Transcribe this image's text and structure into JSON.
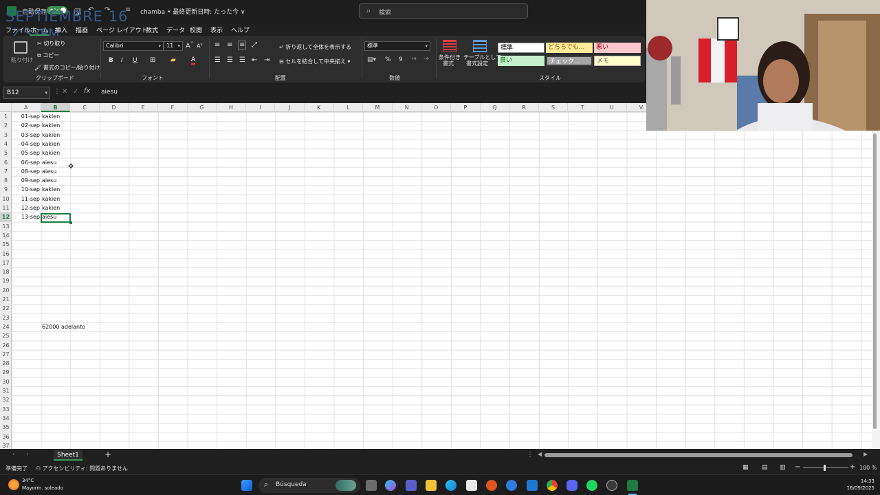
{
  "overlay": {
    "date": "SEPTIEMBRE 16",
    "time": "2:33PM"
  },
  "titlebar": {
    "autosave_label": "自動保存",
    "autosave_state": "オン",
    "doc_title": "chamba • 最終更新日時: たった今 ∨",
    "search_placeholder": "検索"
  },
  "menu_tabs": [
    "ファイル",
    "ホーム",
    "挿入",
    "描画",
    "ページ レイアウト",
    "数式",
    "データ",
    "校閲",
    "表示",
    "ヘルプ"
  ],
  "ribbon": {
    "clipboard": {
      "paste": "貼り付け",
      "cut": "切り取り",
      "copy": "コピー",
      "format_painter": "書式のコピー/貼り付け",
      "label": "クリップボード"
    },
    "font": {
      "name": "Calibri",
      "size": "11",
      "grow": "A",
      "shrink": "A",
      "bold": "B",
      "italic": "I",
      "underline": "U",
      "font_color": "A",
      "label": "フォント"
    },
    "alignment": {
      "wrap": "折り返して全体を表示する",
      "merge": "セルを結合して中央揃え",
      "label": "配置"
    },
    "number": {
      "format": "標準",
      "percent": "%",
      "comma": "9",
      "label": "数値"
    },
    "styles": {
      "conditional": [
        "条件付き",
        "書式"
      ],
      "table": [
        "テーブルとして",
        "書式設定"
      ],
      "cells": [
        "標準",
        "どちらでも...",
        "悪い",
        "良い",
        "チェック...",
        "メモ"
      ],
      "label": "スタイル"
    }
  },
  "formula_bar": {
    "cell_ref": "B12",
    "fx": "fx",
    "value": "aiesu"
  },
  "grid": {
    "columns": [
      "A",
      "B",
      "C",
      "D",
      "E",
      "F",
      "G",
      "H",
      "I",
      "J",
      "K",
      "L",
      "M",
      "N",
      "O",
      "P",
      "Q",
      "R",
      "S",
      "T",
      "U",
      "V"
    ],
    "row_count": 37,
    "rows": [
      {
        "date": "01-sep",
        "value": "kakien"
      },
      {
        "date": "02-sep",
        "value": "kakien"
      },
      {
        "date": "03-sep",
        "value": "kakien"
      },
      {
        "date": "04-sep",
        "value": "kakien"
      },
      {
        "date": "05-sep",
        "value": "kakien"
      },
      {
        "date": "06-sep",
        "value": "aiesu"
      },
      {
        "date": "08-sep",
        "value": "aiesu"
      },
      {
        "date": "09-sep",
        "value": "aiesu"
      },
      {
        "date": "10-sep",
        "value": "kakien"
      },
      {
        "date": "11-sep",
        "value": "kakien"
      },
      {
        "date": "12-sep",
        "value": "kakien"
      },
      {
        "date": "13-sep",
        "value": "aiesu"
      }
    ],
    "note": "62000 adelanto"
  },
  "sheets": {
    "active": "Sheet1",
    "add": "+"
  },
  "status": {
    "ready": "準備完了",
    "accessibility": "アクセシビリティ: 問題ありません",
    "zoom": "100 %"
  },
  "taskbar": {
    "weather_temp": "34°C",
    "weather_desc": "Mayorm. soleado",
    "search": "Búsqueda",
    "time": "14:33",
    "date": "16/09/2025"
  },
  "colors": {
    "excel_green": "#1f7a43",
    "title_bg": "#1d1d1d",
    "ribbon_bg": "#2d2d2d"
  }
}
